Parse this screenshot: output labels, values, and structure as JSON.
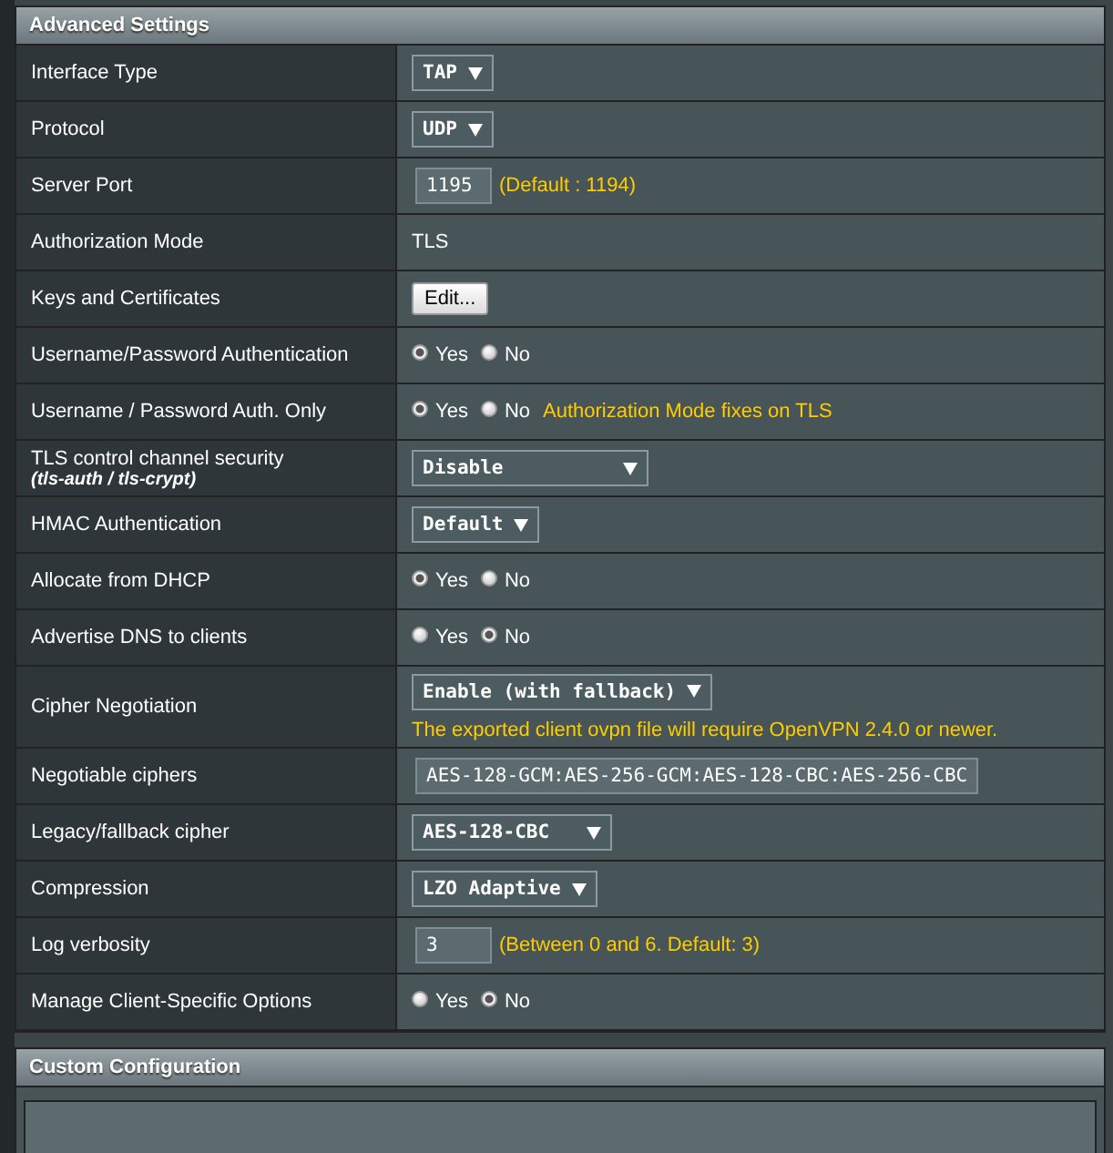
{
  "sections": [
    {
      "title": "Advanced Settings",
      "rows": [
        {
          "label": "Interface Type",
          "kind": "select",
          "value": "TAP"
        },
        {
          "label": "Protocol",
          "kind": "select",
          "value": "UDP"
        },
        {
          "label": "Server Port",
          "kind": "input",
          "value": "1195",
          "note": "(Default : 1194)"
        },
        {
          "label": "Authorization Mode",
          "kind": "text",
          "value": "TLS"
        },
        {
          "label": "Keys and Certificates",
          "kind": "button",
          "value": "Edit..."
        },
        {
          "label": "Username/Password Authentication",
          "kind": "radio",
          "options": [
            {
              "label": "Yes",
              "selected": true
            },
            {
              "label": "No",
              "selected": false
            }
          ]
        },
        {
          "label": "Username / Password Auth. Only",
          "kind": "radio",
          "options": [
            {
              "label": "Yes",
              "selected": true
            },
            {
              "label": "No",
              "selected": false
            }
          ],
          "note": "Authorization Mode fixes on TLS"
        },
        {
          "label": "TLS control channel security",
          "sublabel": "(tls-auth / tls-crypt)",
          "kind": "select",
          "value": "Disable"
        },
        {
          "label": "HMAC Authentication",
          "kind": "select",
          "value": "Default"
        },
        {
          "label": "Allocate from DHCP",
          "kind": "radio",
          "options": [
            {
              "label": "Yes",
              "selected": true
            },
            {
              "label": "No",
              "selected": false
            }
          ]
        },
        {
          "label": "Advertise DNS to clients",
          "kind": "radio",
          "options": [
            {
              "label": "Yes",
              "selected": false
            },
            {
              "label": "No",
              "selected": true
            }
          ]
        },
        {
          "label": "Cipher Negotiation",
          "kind": "select",
          "value": "Enable (with fallback)",
          "below_note": "The exported client ovpn file will require OpenVPN 2.4.0 or newer."
        },
        {
          "label": "Negotiable ciphers",
          "kind": "input",
          "value": "AES-128-GCM:AES-256-GCM:AES-128-CBC:AES-256-CBC"
        },
        {
          "label": "Legacy/fallback cipher",
          "kind": "select",
          "value": "AES-128-CBC"
        },
        {
          "label": "Compression",
          "kind": "select",
          "value": "LZO Adaptive"
        },
        {
          "label": "Log verbosity",
          "kind": "input",
          "value": "3",
          "note": "(Between 0 and 6. Default: 3)"
        },
        {
          "label": "Manage Client-Specific Options",
          "kind": "radio",
          "options": [
            {
              "label": "Yes",
              "selected": false
            },
            {
              "label": "No",
              "selected": true
            }
          ]
        }
      ]
    },
    {
      "title": "Custom Configuration",
      "rows": [
        {
          "kind": "textarea",
          "value": ""
        }
      ]
    }
  ]
}
